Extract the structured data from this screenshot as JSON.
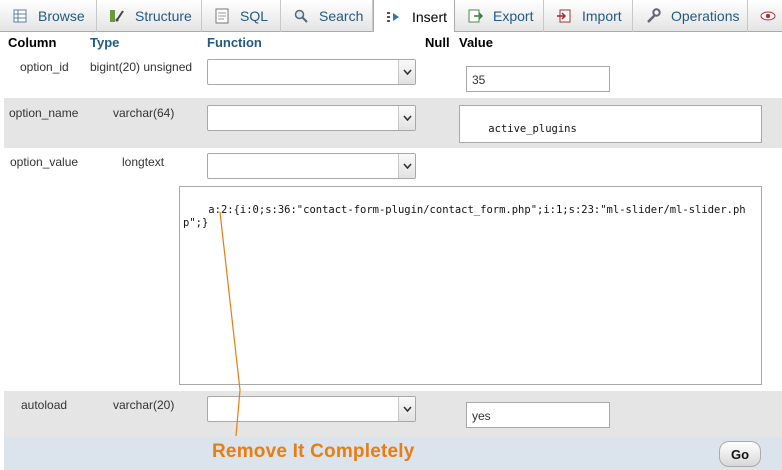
{
  "tabs": [
    {
      "label": "Browse",
      "icon": "browse-icon"
    },
    {
      "label": "Structure",
      "icon": "structure-icon"
    },
    {
      "label": "SQL",
      "icon": "sql-icon"
    },
    {
      "label": "Search",
      "icon": "search-icon"
    },
    {
      "label": "Insert",
      "icon": "insert-icon",
      "active": true
    },
    {
      "label": "Export",
      "icon": "export-icon"
    },
    {
      "label": "Import",
      "icon": "import-icon"
    },
    {
      "label": "Operations",
      "icon": "operations-icon"
    }
  ],
  "header": {
    "column": "Column",
    "type": "Type",
    "function": "Function",
    "null": "Null",
    "value": "Value"
  },
  "rows": [
    {
      "column": "option_id",
      "type": "bigint(20) unsigned",
      "function": "",
      "value": "35"
    },
    {
      "column": "option_name",
      "type": "varchar(64)",
      "function": "",
      "value": "active_plugins"
    },
    {
      "column": "option_value",
      "type": "longtext",
      "function": "",
      "value": "a:2:{i:0;s:36:\"contact-form-plugin/contact_form.php\";i:1;s:23:\"ml-slider/ml-slider.php\";}"
    },
    {
      "column": "autoload",
      "type": "varchar(20)",
      "function": "",
      "value": "yes"
    }
  ],
  "annotation": "Remove It Completely",
  "go_label": "Go",
  "colors": {
    "link": "#235a81",
    "annotation": "#e87d10",
    "footer_bg": "#dbe3ec",
    "row_alt": "#e5e5e5"
  }
}
